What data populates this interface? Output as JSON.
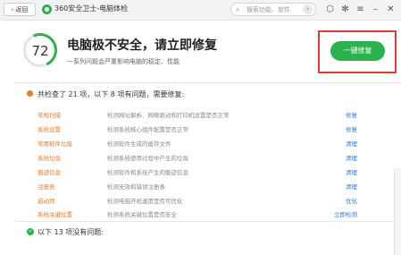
{
  "titlebar": {
    "back_label": "返回",
    "app_title": "360安全卫士-电脑体检",
    "search_placeholder": "搜索功能、软件",
    "search_go": "›"
  },
  "header": {
    "score": "72",
    "headline": "电脑极不安全，请立即修复",
    "subline": "一系列问题会严重影响电脑的稳定、性能",
    "fix_button": "一键修复"
  },
  "issues": {
    "summary": "共检查了 21 项，以下 8 项有问题，需要修复:",
    "rows": [
      {
        "name": "常规扫描",
        "desc": "检测网址解析、网络驱动和打印机设置是否正常",
        "action": "修复"
      },
      {
        "name": "系统设置",
        "desc": "检测系统核心组件配置是否正常",
        "action": "修复"
      },
      {
        "name": "常用软件垃圾",
        "desc": "检测软件生成的缓存文件",
        "action": "清理"
      },
      {
        "name": "系统垃圾",
        "desc": "检测系统使用过程中产生的垃圾",
        "action": "清理"
      },
      {
        "name": "痕迹信息",
        "desc": "检测软件和系统产生的痕迹信息",
        "action": "清理"
      },
      {
        "name": "注册表",
        "desc": "检测无效和错误注册表",
        "action": "清理"
      },
      {
        "name": "启动项",
        "desc": "检测电脑开机速度是否可优化",
        "action": "优化"
      },
      {
        "name": "系统关键位置",
        "desc": "检测系统关键位置是否安全",
        "action": "立即检测"
      }
    ]
  },
  "ok_section": {
    "title": "以下 13 项没有问题:"
  },
  "colors": {
    "accent_green": "#2bb24c",
    "warning_orange": "#e8792c",
    "link_blue": "#2a7ad6",
    "highlight_red": "#e03b3b"
  }
}
